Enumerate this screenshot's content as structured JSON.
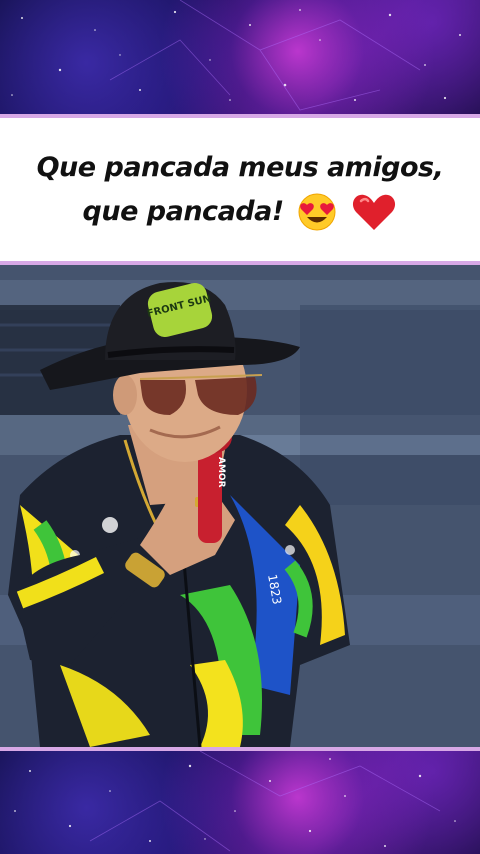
{
  "caption": {
    "line1": "Que pancada meus amigos,",
    "line2": "que pancada!",
    "emojis": [
      "smiling-face-with-heart-eyes-emoji",
      "red-heart-emoji"
    ]
  },
  "photo": {
    "hat_patch_text": "FRONT SUN",
    "mic_text": "AMOR",
    "shirt_text": "1823"
  },
  "colors": {
    "divider": "#d7a8e6",
    "caption_bg": "#ffffff",
    "caption_text": "#111111"
  }
}
